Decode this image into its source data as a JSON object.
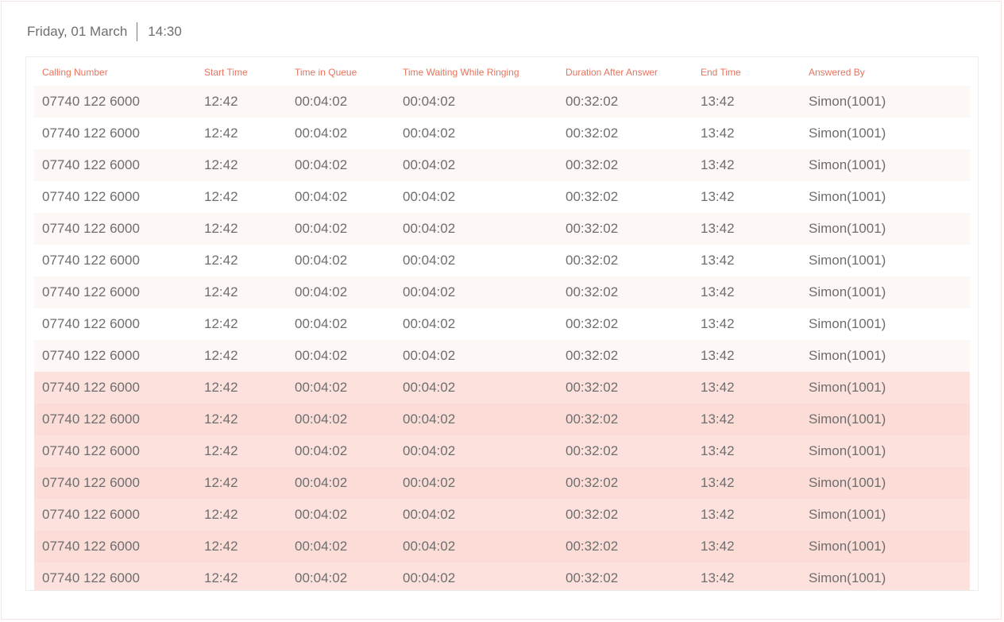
{
  "header": {
    "date": "Friday, 01 March",
    "time": "14:30"
  },
  "table": {
    "columns": [
      "Calling Number",
      "Start Time",
      "Time in Queue",
      "Time Waiting While Ringing",
      "Duration After Answer",
      "End Time",
      "Answered By"
    ],
    "rows": [
      [
        "07740 122 6000",
        "12:42",
        "00:04:02",
        "00:04:02",
        "00:32:02",
        "13:42",
        "Simon(1001)"
      ],
      [
        "07740 122 6000",
        "12:42",
        "00:04:02",
        "00:04:02",
        "00:32:02",
        "13:42",
        "Simon(1001)"
      ],
      [
        "07740 122 6000",
        "12:42",
        "00:04:02",
        "00:04:02",
        "00:32:02",
        "13:42",
        "Simon(1001)"
      ],
      [
        "07740 122 6000",
        "12:42",
        "00:04:02",
        "00:04:02",
        "00:32:02",
        "13:42",
        "Simon(1001)"
      ],
      [
        "07740 122 6000",
        "12:42",
        "00:04:02",
        "00:04:02",
        "00:32:02",
        "13:42",
        "Simon(1001)"
      ],
      [
        "07740 122 6000",
        "12:42",
        "00:04:02",
        "00:04:02",
        "00:32:02",
        "13:42",
        "Simon(1001)"
      ],
      [
        "07740 122 6000",
        "12:42",
        "00:04:02",
        "00:04:02",
        "00:32:02",
        "13:42",
        "Simon(1001)"
      ],
      [
        "07740 122 6000",
        "12:42",
        "00:04:02",
        "00:04:02",
        "00:32:02",
        "13:42",
        "Simon(1001)"
      ],
      [
        "07740 122 6000",
        "12:42",
        "00:04:02",
        "00:04:02",
        "00:32:02",
        "13:42",
        "Simon(1001)"
      ],
      [
        "07740 122 6000",
        "12:42",
        "00:04:02",
        "00:04:02",
        "00:32:02",
        "13:42",
        "Simon(1001)"
      ],
      [
        "07740 122 6000",
        "12:42",
        "00:04:02",
        "00:04:02",
        "00:32:02",
        "13:42",
        "Simon(1001)"
      ],
      [
        "07740 122 6000",
        "12:42",
        "00:04:02",
        "00:04:02",
        "00:32:02",
        "13:42",
        "Simon(1001)"
      ],
      [
        "07740 122 6000",
        "12:42",
        "00:04:02",
        "00:04:02",
        "00:32:02",
        "13:42",
        "Simon(1001)"
      ],
      [
        "07740 122 6000",
        "12:42",
        "00:04:02",
        "00:04:02",
        "00:32:02",
        "13:42",
        "Simon(1001)"
      ],
      [
        "07740 122 6000",
        "12:42",
        "00:04:02",
        "00:04:02",
        "00:32:02",
        "13:42",
        "Simon(1001)"
      ],
      [
        "07740 122 6000",
        "12:42",
        "00:04:02",
        "00:04:02",
        "00:32:02",
        "13:42",
        "Simon(1001)"
      ]
    ],
    "highlighted_rows_from": 9
  },
  "colors": {
    "header_text": "#e8735d",
    "body_text": "#6e6e6e",
    "row_stripe": "#fdf7f5",
    "row_highlight": "#fde1dd",
    "row_highlight_alt": "#fbdcd7"
  }
}
